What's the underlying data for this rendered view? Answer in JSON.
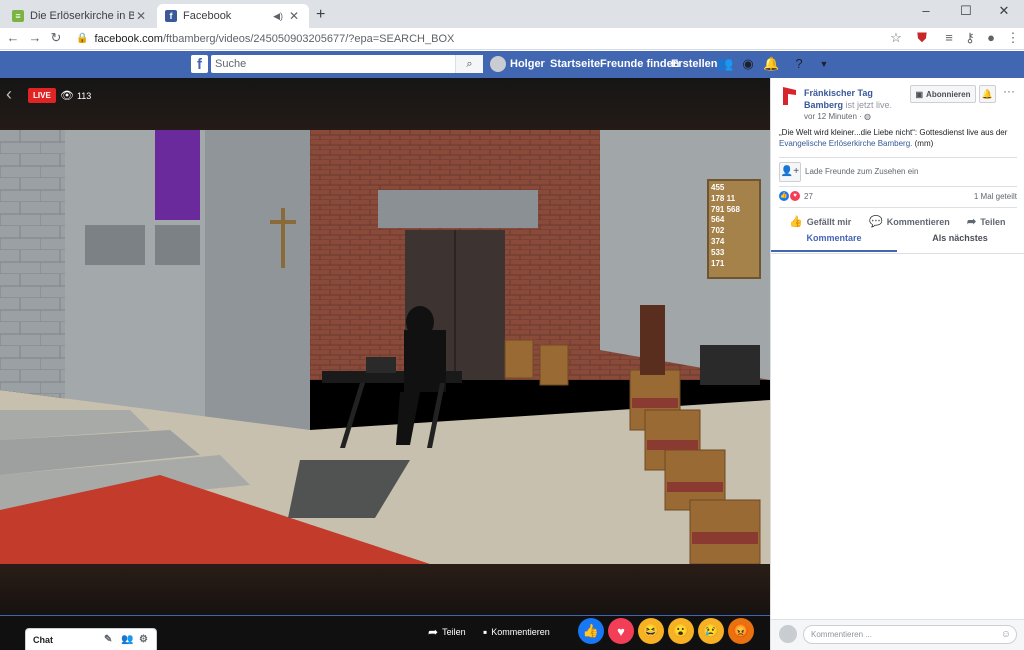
{
  "browser": {
    "tabs": [
      {
        "title": "Die Erlöserkirche in Bamberg ist hier...",
        "active": false
      },
      {
        "title": "Facebook",
        "active": true
      }
    ],
    "new_tab": "+",
    "url_host": "facebook.com",
    "url_path": "/ftbamberg/videos/245050903205677/?epa=SEARCH_BOX",
    "window_controls": [
      "–",
      "☐",
      "✕"
    ]
  },
  "fb": {
    "search_placeholder": "Suche",
    "user": "Holger",
    "nav": [
      "Startseite",
      "Freunde finden",
      "Erstellen"
    ]
  },
  "video": {
    "live_badge": "LIVE",
    "viewers": "113",
    "share_label": "Teilen",
    "comment_label": "Kommentieren",
    "reactions": [
      {
        "name": "like",
        "glyph": "👍",
        "color": "#1877f2"
      },
      {
        "name": "love",
        "glyph": "♥",
        "color": "#f33e58"
      },
      {
        "name": "haha",
        "glyph": "😆",
        "color": "#f7b125"
      },
      {
        "name": "wow",
        "glyph": "😮",
        "color": "#f7b125"
      },
      {
        "name": "sad",
        "glyph": "😢",
        "color": "#f7b125"
      },
      {
        "name": "angry",
        "glyph": "😡",
        "color": "#e9710f"
      }
    ],
    "hymn_board": [
      "455",
      "178 11",
      "791 568",
      "564",
      "702",
      "374",
      "533",
      "171"
    ]
  },
  "chat": {
    "label": "Chat"
  },
  "panel": {
    "page_name": "Fränkischer Tag Bamberg",
    "status": "ist jetzt live.",
    "time": "vor 12 Minuten · ",
    "subscribe": "Abonnieren",
    "description": "„Die Welt wird kleiner...die Liebe nicht“: Gottesdienst live aus der",
    "description_link": "Evangelische Erlöserkirche Bamberg.",
    "description_tail": " (mm)",
    "invite": "Lade Freunde zum Zusehen ein",
    "reaction_count": "27",
    "shares": "1 Mal geteilt",
    "like": "Gefällt mir",
    "comment": "Kommentieren",
    "share": "Teilen",
    "tab_comments": "Kommentare",
    "tab_next": "Als nächstes",
    "comment_placeholder": "Kommentieren ..."
  },
  "colors": {
    "fb_blue": "#4267b2",
    "live_red": "#e02424",
    "link": "#385898"
  }
}
